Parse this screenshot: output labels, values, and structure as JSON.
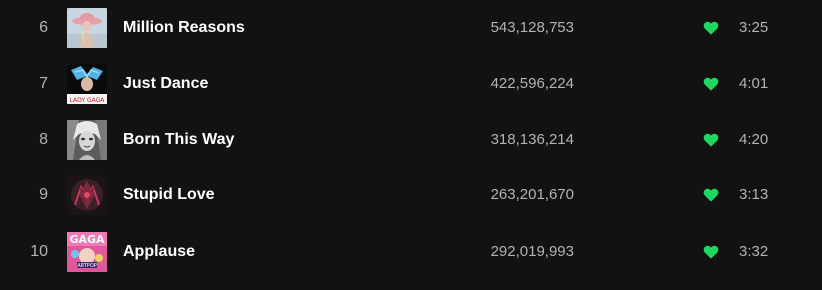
{
  "accent_color": "#1ed760",
  "tracks": [
    {
      "index": "6",
      "title": "Million Reasons",
      "plays": "543,128,753",
      "duration": "3:25",
      "liked": true,
      "art": "album-art-joanne"
    },
    {
      "index": "7",
      "title": "Just Dance",
      "plays": "422,596,224",
      "duration": "4:01",
      "liked": true,
      "art": "album-art-the-fame"
    },
    {
      "index": "8",
      "title": "Born This Way",
      "plays": "318,136,214",
      "duration": "4:20",
      "liked": true,
      "art": "album-art-born-this-way"
    },
    {
      "index": "9",
      "title": "Stupid Love",
      "plays": "263,201,670",
      "duration": "3:13",
      "liked": true,
      "art": "album-art-chromatica"
    },
    {
      "index": "10",
      "title": "Applause",
      "plays": "292,019,993",
      "duration": "3:32",
      "liked": true,
      "art": "album-art-artpop"
    }
  ]
}
